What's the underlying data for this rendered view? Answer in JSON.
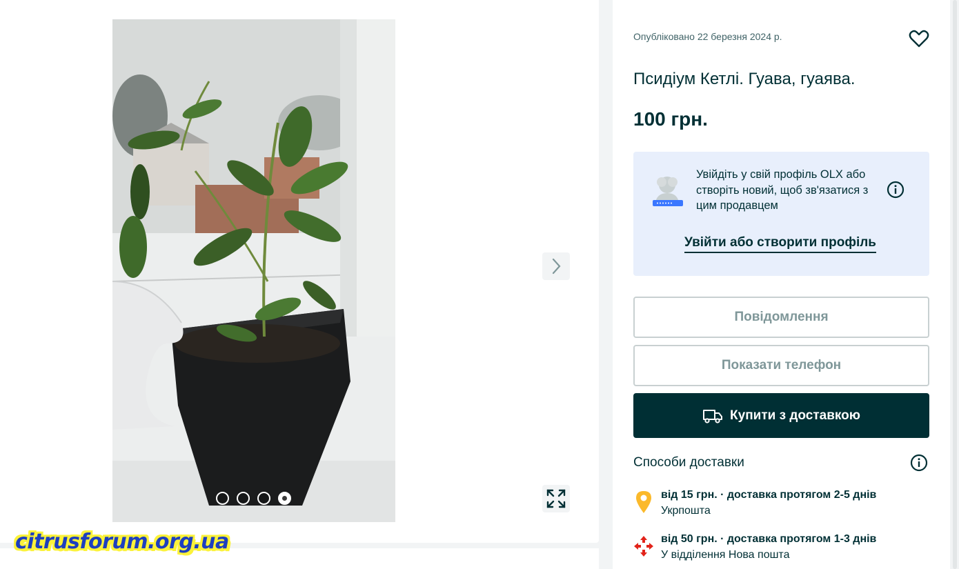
{
  "gallery": {
    "dots": [
      {
        "label": "photo 1",
        "active": false
      },
      {
        "label": "photo 2",
        "active": false
      },
      {
        "label": "photo 3",
        "active": false
      },
      {
        "label": "photo 4",
        "active": true
      }
    ],
    "next_icon": "chevron-right-icon",
    "expand_icon": "expand-icon"
  },
  "watermark": "citrusforum.org.ua",
  "listing": {
    "published": "Опубліковано 22 березня 2024 р.",
    "title": "Псидіум Кетлі. Гуава, гуаява.",
    "price": "100 грн.",
    "favorite_icon": "heart-outline-icon"
  },
  "login_prompt": {
    "text": "Увійдіть у свій профіль OLX або створіть новий, щоб зв'язатися з цим продавцем",
    "link": "Увійти або створити профіль",
    "background": "#e8effc"
  },
  "actions": {
    "message": "Повідомлення",
    "phone": "Показати телефон",
    "buy": "Купити з доставкою",
    "buy_bg": "#002f34"
  },
  "delivery": {
    "title": "Способи доставки",
    "options": [
      {
        "main": "від 15 грн. · доставка протягом 2-5 днів",
        "carrier": "Укрпошта",
        "icon": "location-pin-icon",
        "color": "#fbb92b"
      },
      {
        "main": "від 50 грн. · доставка протягом 1-3 днів",
        "carrier": "У відділення Нова пошта",
        "icon": "nova-poshta-icon",
        "color": "#e2231a"
      }
    ]
  }
}
